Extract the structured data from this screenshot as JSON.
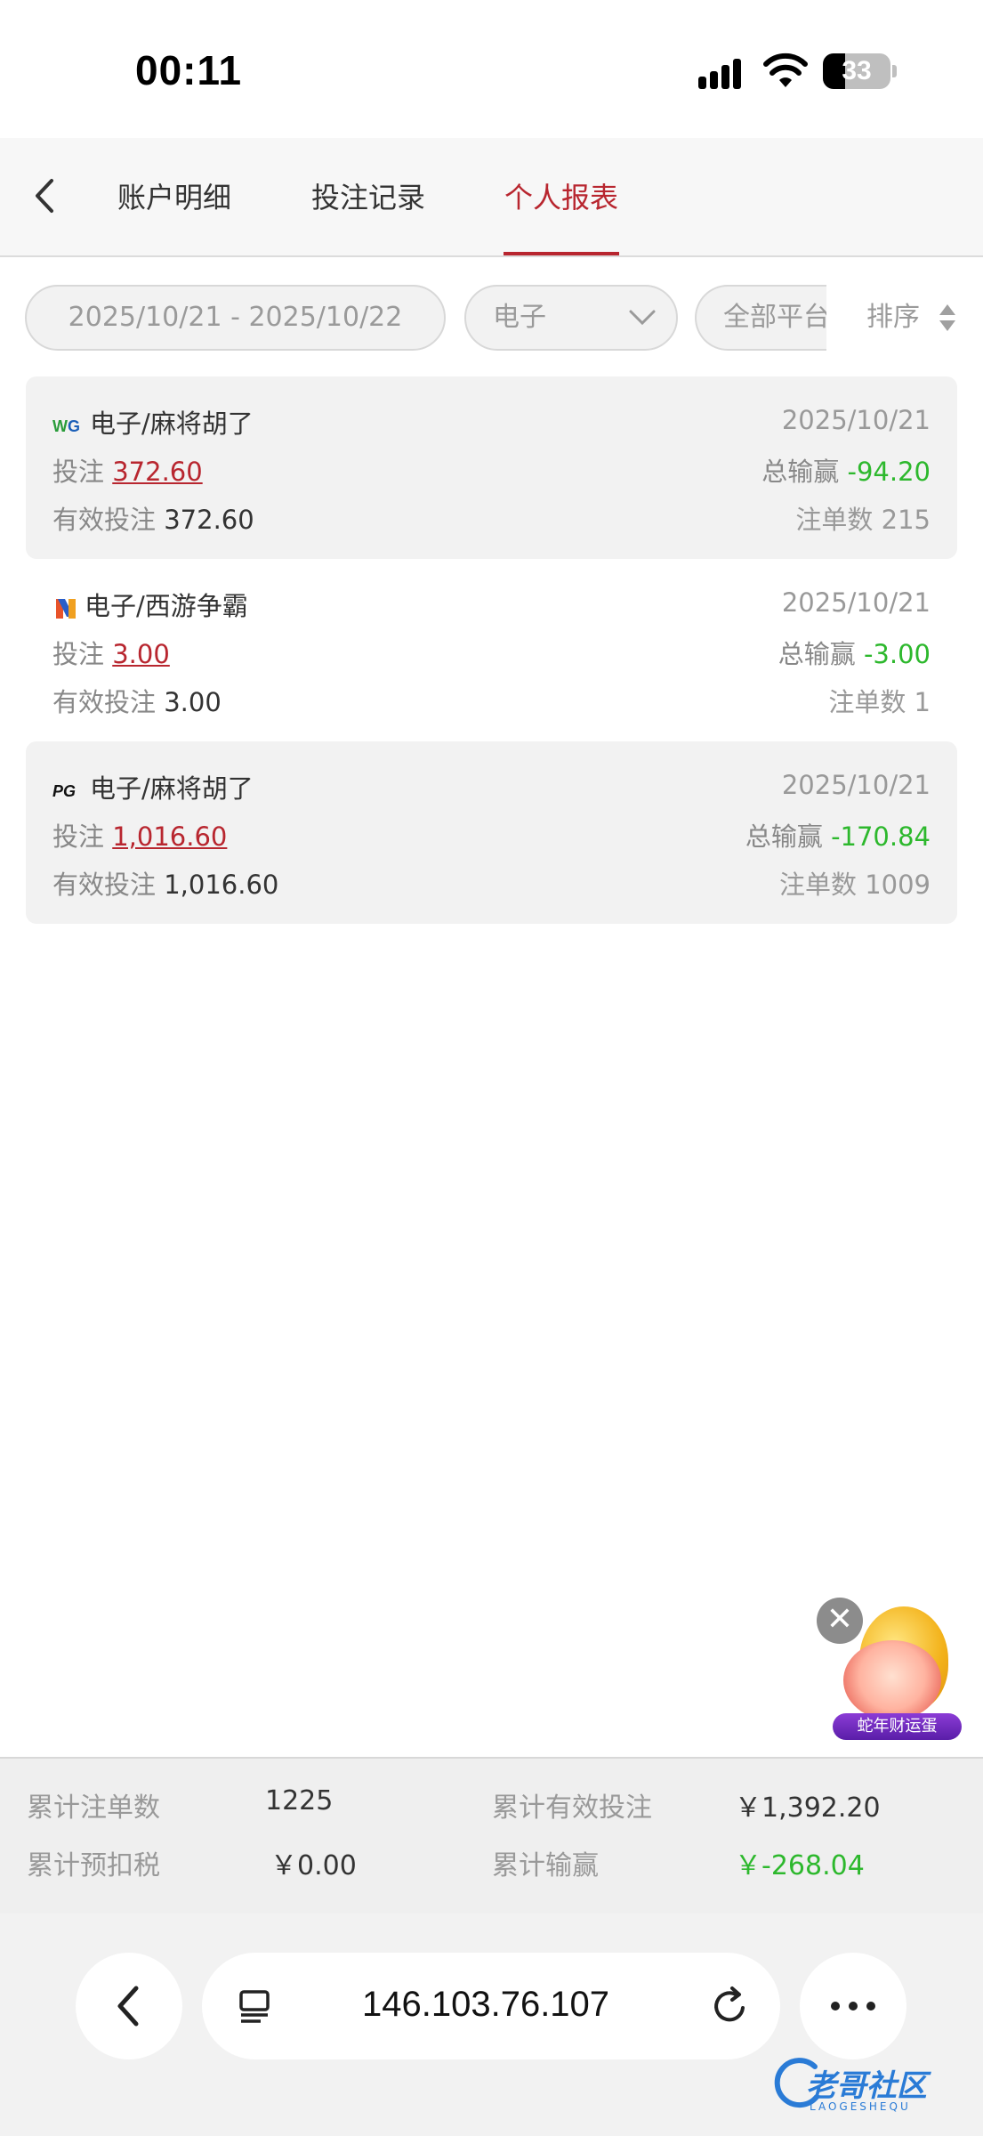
{
  "status_bar": {
    "time": "00:11",
    "battery": "33",
    "battery_level": 0.33
  },
  "header": {
    "tabs": [
      {
        "label": "账户明细",
        "active": false
      },
      {
        "label": "投注记录",
        "active": false
      },
      {
        "label": "个人报表",
        "active": true
      }
    ]
  },
  "filters": {
    "date_range": "2025/10/21 - 2025/10/22",
    "game_type": "电子",
    "platform": "全部平台",
    "sort_label": "排序"
  },
  "labels": {
    "bet": "投注",
    "total_win": "总输赢",
    "valid_bet": "有效投注",
    "order_count": "注单数"
  },
  "records": [
    {
      "provider_logo": "WG",
      "title": "电子/麻将胡了",
      "date": "2025/10/21",
      "bet": "372.60",
      "total_win": "-94.20",
      "valid_bet": "372.60",
      "order_count": "215"
    },
    {
      "provider_logo": "N",
      "title": "电子/西游争霸",
      "date": "2025/10/21",
      "bet": "3.00",
      "total_win": "-3.00",
      "valid_bet": "3.00",
      "order_count": "1"
    },
    {
      "provider_logo": "PG",
      "title": "电子/麻将胡了",
      "date": "2025/10/21",
      "bet": "1,016.60",
      "total_win": "-170.84",
      "valid_bet": "1,016.60",
      "order_count": "1009"
    }
  ],
  "promo": {
    "label": "蛇年财运蛋",
    "close": "✕"
  },
  "summary": {
    "total_orders_label": "累计注单数",
    "total_orders": "1225",
    "total_valid_label": "累计有效投注",
    "total_valid": "￥1,392.20",
    "tax_label": "累计预扣税",
    "tax": "￥0.00",
    "total_win_label": "累计输赢",
    "total_win": "￥-268.04"
  },
  "browser": {
    "url": "146.103.76.107"
  },
  "watermark": {
    "text": "老哥社区",
    "sub": "LAOGESHEQU"
  },
  "colors": {
    "accent": "#b8262f",
    "negative_win": "#2db82d"
  }
}
